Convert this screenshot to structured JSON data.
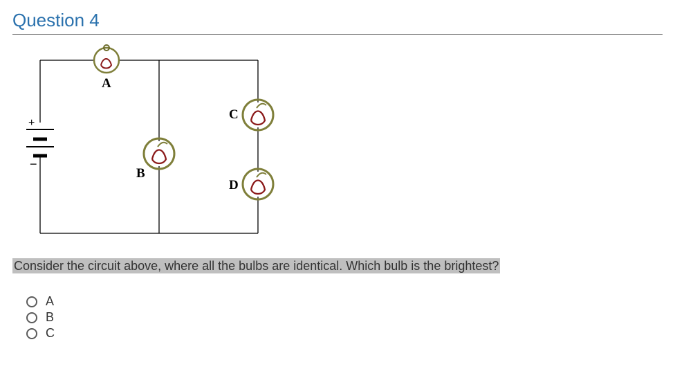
{
  "question": {
    "title": "Question 4",
    "prompt": "Consider the circuit above, where all the bulbs are identical. Which bulb is the brightest?",
    "bulb_labels": {
      "A": "A",
      "B": "B",
      "C": "C",
      "D": "D"
    },
    "battery": {
      "plus": "+",
      "minus": "−"
    },
    "options": [
      {
        "label": "A"
      },
      {
        "label": "B"
      },
      {
        "label": "C"
      }
    ]
  }
}
